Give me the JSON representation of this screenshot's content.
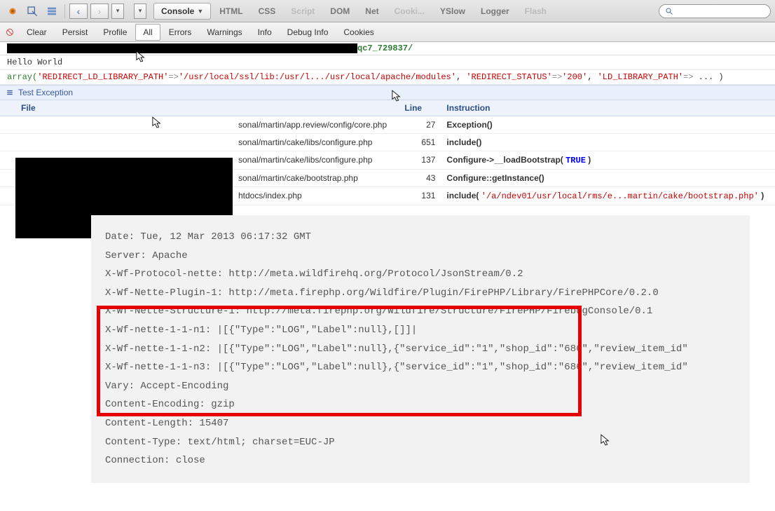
{
  "toolbar": {
    "tabs": [
      "Console",
      "HTML",
      "CSS",
      "Script",
      "DOM",
      "Net",
      "Cooki...",
      "YSlow",
      "Logger",
      "Flash"
    ],
    "active_tab": "Console"
  },
  "subtoolbar": {
    "buttons": [
      "Clear",
      "Persist",
      "Profile",
      "All",
      "Errors",
      "Warnings",
      "Info",
      "Debug Info",
      "Cookies"
    ],
    "active": "All"
  },
  "url_suffix": "qc7_729837/",
  "log_hello": "Hello World",
  "array_line": {
    "prefix": "array(",
    "k1": "'REDIRECT_LD_LIBRARY_PATH'",
    "v1": "'/usr/local/ssl/lib:/usr/l.../usr/local/apache/modules'",
    "k2": "'REDIRECT_STATUS'",
    "v2": "'200'",
    "k3": "'LD_LIBRARY_PATH'",
    "suffix": " ... )"
  },
  "exception_label": "Test Exception",
  "table": {
    "headers": {
      "file": "File",
      "line": "Line",
      "instruction": "Instruction"
    },
    "rows": [
      {
        "file": "sonal/martin/app.review/config/core.php",
        "line": 27,
        "instr_html": "<span class='instr-strong'>Exception()</span>"
      },
      {
        "file": "sonal/martin/cake/libs/configure.php",
        "line": 651,
        "instr_html": "<span class='instr-strong'>include()</span>"
      },
      {
        "file": "sonal/martin/cake/libs/configure.php",
        "line": 137,
        "instr_html": "<span class='instr-strong'>Configure->__loadBootstrap(</span> <span class='mono-blue'>TRUE</span> <span class='instr-strong'>)</span>"
      },
      {
        "file": "sonal/martin/cake/bootstrap.php",
        "line": 43,
        "instr_html": "<span class='instr-strong'>Configure::getInstance()</span>"
      },
      {
        "file": "htdocs/index.php",
        "line": 131,
        "instr_html": "<span class='instr-strong'>include(</span> <span class='mono-red'>'/a/ndev01/usr/local/rms/e...martin/cake/bootstrap.php'</span> <span class='instr-strong'>)</span>"
      }
    ]
  },
  "headers_panel": [
    "Date: Tue, 12 Mar 2013 06:17:32 GMT",
    "Server: Apache",
    "X-Wf-Protocol-nette: http://meta.wildfirehq.org/Protocol/JsonStream/0.2",
    "X-Wf-Nette-Plugin-1: http://meta.firephp.org/Wildfire/Plugin/FirePHP/Library/FirePHPCore/0.2.0",
    "X-Wf-Nette-Structure-1: http://meta.firephp.org/Wildfire/Structure/FirePHP/FirebugConsole/0.1",
    "X-Wf-nette-1-1-n1: |[{\"Type\":\"LOG\",\"Label\":null},[]]|",
    "X-Wf-nette-1-1-n2: |[{\"Type\":\"LOG\",\"Label\":null},{\"service_id\":\"1\",\"shop_id\":\"686\",\"review_item_id\"",
    "X-Wf-nette-1-1-n3: |[{\"Type\":\"LOG\",\"Label\":null},{\"service_id\":\"1\",\"shop_id\":\"686\",\"review_item_id\"",
    "Vary: Accept-Encoding",
    "Content-Encoding: gzip",
    "Content-Length: 15407",
    "Content-Type: text/html; charset=EUC-JP",
    "Connection: close"
  ]
}
